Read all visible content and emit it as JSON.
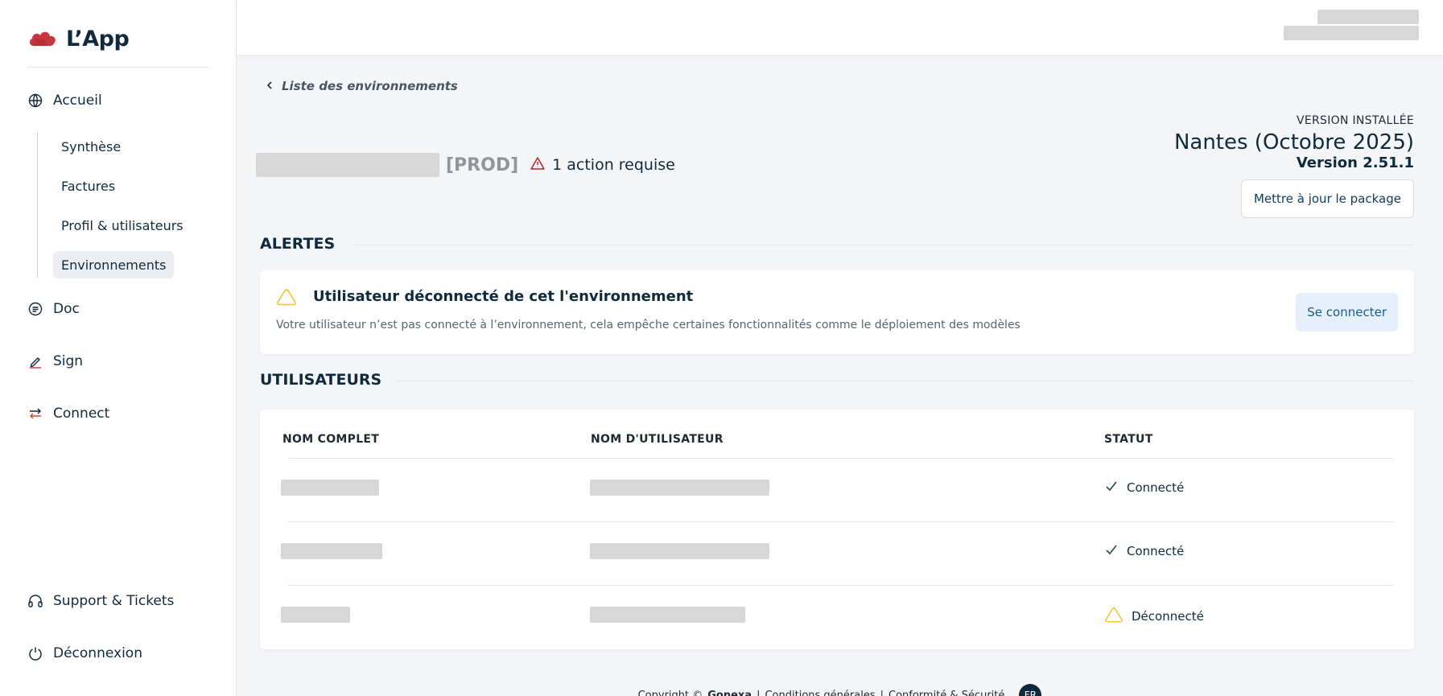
{
  "app": {
    "name": "L’App"
  },
  "sidebar": {
    "items": [
      {
        "label": "Accueil",
        "icon": "globe-icon"
      },
      {
        "label": "Doc",
        "icon": "document-icon"
      },
      {
        "label": "Sign",
        "icon": "pen-icon"
      },
      {
        "label": "Connect",
        "icon": "arrows-icon"
      }
    ],
    "subitems": [
      {
        "label": "Synthèse"
      },
      {
        "label": "Factures"
      },
      {
        "label": "Profil & utilisateurs"
      },
      {
        "label": "Environnements",
        "active": true
      }
    ],
    "bottom": [
      {
        "label": "Support & Tickets",
        "icon": "headset-icon"
      },
      {
        "label": "Déconnexion",
        "icon": "power-icon"
      }
    ]
  },
  "breadcrumb": {
    "back_label": "Liste des environnements"
  },
  "environment": {
    "tag": "[PROD]",
    "action_required": "1 action requise"
  },
  "version": {
    "label": "VERSION INSTALLÉE",
    "name": "Nantes (Octobre 2025)",
    "number": "Version 2.51.1",
    "update_button": "Mettre à jour le package"
  },
  "alerts": {
    "section_title": "ALERTES",
    "items": [
      {
        "title": "Utilisateur déconnecté de cet l'environnement",
        "description": "Votre utilisateur n’est pas connecté à l’environnement, cela empêche certaines fonctionnalités comme le déploiement des modèles",
        "action_label": "Se connecter"
      }
    ]
  },
  "users": {
    "section_title": "UTILISATEURS",
    "columns": [
      "NOM COMPLET",
      "NOM D'UTILISATEUR",
      "STATUT"
    ],
    "rows": [
      {
        "status": "Connecté",
        "status_icon": "check-icon"
      },
      {
        "status": "Connecté",
        "status_icon": "check-icon"
      },
      {
        "status": "Déconnecté",
        "status_icon": "warning-icon"
      }
    ]
  },
  "footer": {
    "copyright_prefix": "Copyright ©",
    "company": "Gonexa",
    "links": [
      "Conditions générales",
      "Conformité & Sécurité"
    ],
    "separator": "|",
    "language": "FR"
  },
  "colors": {
    "brand_red": "#c8373f",
    "navy": "#0f2a3d",
    "warning_yellow": "#f2c744",
    "connect_bg": "#e5f0fa"
  }
}
